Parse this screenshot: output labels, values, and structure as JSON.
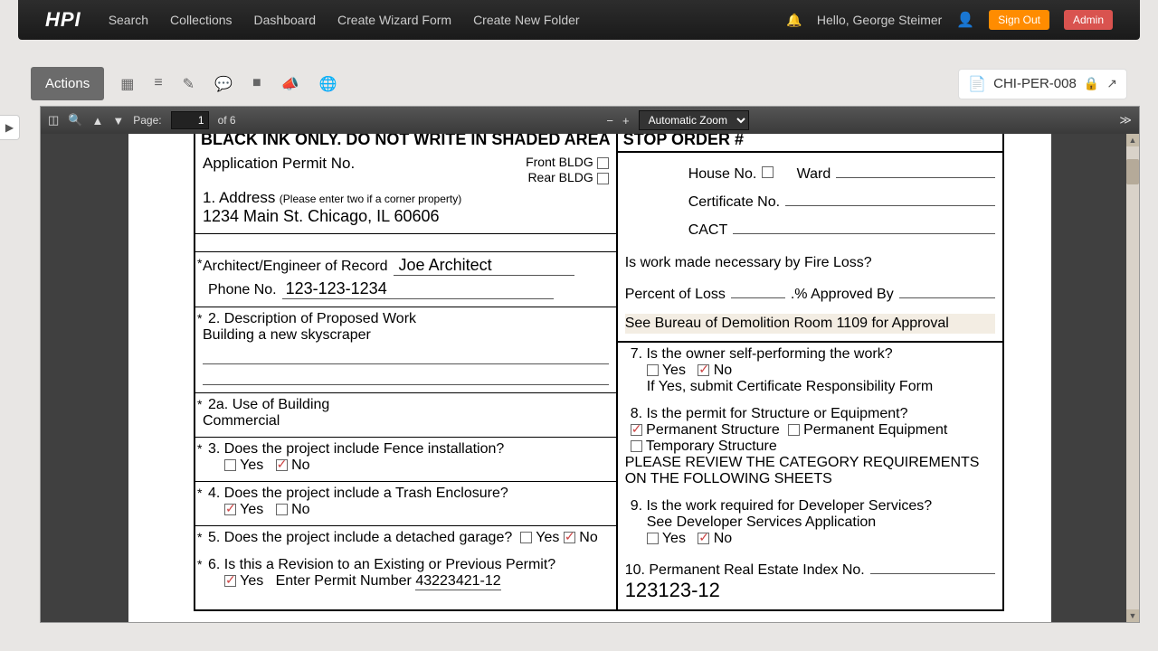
{
  "nav": {
    "logo": "HPI",
    "links": [
      "Search",
      "Collections",
      "Dashboard",
      "Create Wizard Form",
      "Create New Folder"
    ],
    "hello": "Hello, George Steimer",
    "sign_out": "Sign Out",
    "admin": "Admin"
  },
  "toolbar": {
    "actions": "Actions",
    "doc_id": "CHI-PER-008"
  },
  "viewer": {
    "page_label": "Page:",
    "page": "1",
    "of": "of 6",
    "zoom": "Automatic Zoom"
  },
  "form": {
    "header_left": "BLACK INK ONLY. DO NOT WRITE IN SHADED AREA",
    "header_right": "STOP ORDER #",
    "app_permit": "Application Permit No.",
    "front_bldg": "Front BLDG",
    "rear_bldg": "Rear BLDG",
    "q1_label": "1. Address",
    "q1_hint": "(Please enter two if a corner property)",
    "q1_val": "1234 Main St. Chicago, IL 60606",
    "arch_label": "Architect/Engineer of Record",
    "arch_val": "Joe Architect",
    "phone_label": "Phone No.",
    "phone_val": "123-123-1234",
    "q2_label": "2. Description of Proposed Work",
    "q2_val": "Building a new skyscraper",
    "q2a_label": "2a. Use of Building",
    "q2a_val": "Commercial",
    "q3_label": "3. Does the project include Fence installation?",
    "q4_label": "4. Does the project include a Trash Enclosure?",
    "q5_label": "5. Does the project include a detached garage?",
    "q6_label": "6. Is this a Revision to an Existing or Previous Permit?",
    "q6_enter": "Enter Permit Number",
    "q6_val": "43223421-12",
    "yes": "Yes",
    "no": "No",
    "house_no": "House No.",
    "ward": "Ward",
    "cert_no": "Certificate No.",
    "cact": "CACT",
    "fire_loss": "Is work made necessary by Fire Loss?",
    "pct_loss": "Percent of Loss",
    "pct_approved": ".% Approved By",
    "bureau": "See Bureau of Demolition Room 1109 for Approval",
    "q7_label": "7. Is the owner self-performing the work?",
    "q7_note": "If Yes, submit Certificate Responsibility Form",
    "q8_label": "8. Is the permit for Structure or Equipment?",
    "q8_a": "Permanent Structure",
    "q8_b": "Permanent Equipment",
    "q8_c": "Temporary Structure",
    "q8_note": "PLEASE REVIEW THE CATEGORY REQUIREMENTS ON THE FOLLOWING SHEETS",
    "q9_label": "9. Is the work required for Developer Services?",
    "q9_note": "See Developer Services Application",
    "q10_label": "10. Permanent Real Estate Index No.",
    "q10_val": "123123-12"
  }
}
